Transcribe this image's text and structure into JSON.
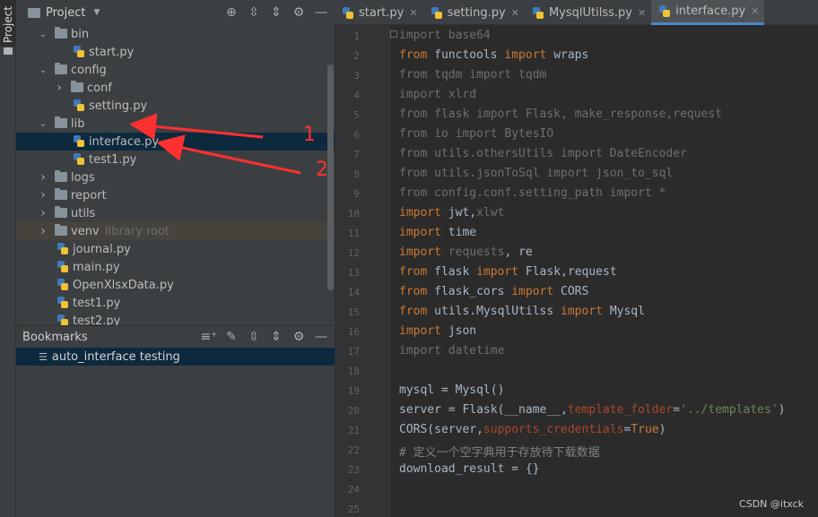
{
  "side_strip": {
    "project_tab": "Project"
  },
  "project_panel": {
    "title": "Project",
    "tree": [
      {
        "label": "bin",
        "type": "folder",
        "depth": 1,
        "state": "expanded"
      },
      {
        "label": "start.py",
        "type": "py",
        "depth": 2
      },
      {
        "label": "config",
        "type": "folder",
        "depth": 1,
        "state": "expanded"
      },
      {
        "label": "conf",
        "type": "folder",
        "depth": 2,
        "state": "collapsed"
      },
      {
        "label": "setting.py",
        "type": "py",
        "depth": 2
      },
      {
        "label": "lib",
        "type": "folder",
        "depth": 1,
        "state": "expanded"
      },
      {
        "label": "interface.py",
        "type": "py",
        "depth": 2,
        "selected": true
      },
      {
        "label": "test1.py",
        "type": "py",
        "depth": 2
      },
      {
        "label": "logs",
        "type": "folder",
        "depth": 1,
        "state": "collapsed"
      },
      {
        "label": "report",
        "type": "folder",
        "depth": 1,
        "state": "collapsed"
      },
      {
        "label": "utils",
        "type": "folder",
        "depth": 1,
        "state": "collapsed"
      },
      {
        "label": "venv",
        "type": "folder",
        "depth": 1,
        "state": "collapsed",
        "suffix": "library root"
      },
      {
        "label": "journal.py",
        "type": "py",
        "depth": 1
      },
      {
        "label": "main.py",
        "type": "py",
        "depth": 1
      },
      {
        "label": "OpenXlsxData.py",
        "type": "py",
        "depth": 1
      },
      {
        "label": "test1.py",
        "type": "py",
        "depth": 1
      },
      {
        "label": "test2.py",
        "type": "py",
        "depth": 1
      }
    ]
  },
  "bookmarks": {
    "title": "Bookmarks",
    "items": [
      "auto_interface testing"
    ]
  },
  "tabs": [
    {
      "label": "start.py",
      "active": false
    },
    {
      "label": "setting.py",
      "active": false
    },
    {
      "label": "MysqlUtilss.py",
      "active": false
    },
    {
      "label": "interface.py",
      "active": true
    }
  ],
  "editor": {
    "lines": [
      "import base64",
      "from functools import wraps",
      "from tqdm import tqdm",
      "import xlrd",
      "from flask import Flask, make_response,request",
      "from io import BytesIO",
      "from utils.othersUtils import DateEncoder",
      "from utils.jsonToSql import json_to_sql",
      "from config.conf.setting_path import *",
      "import jwt,xlwt",
      "import time",
      "import requests, re",
      "from flask import Flask,request",
      "from flask_cors import CORS",
      "from utils.MysqlUtilss import Mysql",
      "import json",
      "import datetime",
      "",
      "mysql = Mysql()",
      "server = Flask(__name__,template_folder='../templates')",
      "CORS(server,supports_credentials=True)",
      "# 定义一个空字典用于存放待下载数据",
      "download_result = {}",
      "",
      ""
    ]
  },
  "annotations": {
    "arrow1_number": "1",
    "arrow2_number": "2",
    "arrow_color": "#ff3030"
  },
  "watermark": "CSDN @itxck"
}
